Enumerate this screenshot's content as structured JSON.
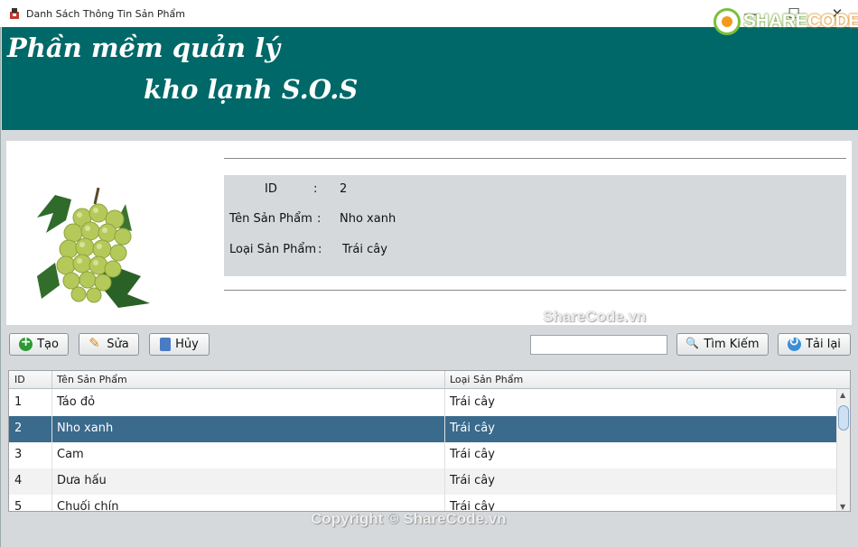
{
  "window": {
    "title": "Danh Sách Thông Tin Sản Phẩm",
    "minimize_glyph": "—",
    "maximize_glyph": "☐",
    "close_glyph": "✕"
  },
  "logo": {
    "share": "SHARE",
    "code": "CODE.vn"
  },
  "banner": {
    "line1": "Phần mềm quản lý",
    "line2": "kho lạnh S.O.S",
    "background": "#006868"
  },
  "details": {
    "id_label": "ID",
    "id_sep": ":",
    "id_value": "2",
    "name_label": "Tên Sản Phẩm",
    "name_sep": ":",
    "name_value": "Nho xanh",
    "type_label": "Loại Sản Phẩm",
    "type_sep": ":",
    "type_value": "Trái cây"
  },
  "watermark": "ShareCode.vn",
  "toolbar": {
    "create": "Tạo",
    "edit": "Sửa",
    "cancel": "Hủy",
    "search_value": "",
    "search": "Tìm Kiếm",
    "reload": "Tải lại"
  },
  "table": {
    "headers": [
      "ID",
      "Tên Sản Phẩm",
      "Loại Sản Phẩm"
    ],
    "rows": [
      {
        "id": "1",
        "name": "Táo đỏ",
        "type": "Trái cây"
      },
      {
        "id": "2",
        "name": "Nho xanh",
        "type": "Trái cây"
      },
      {
        "id": "3",
        "name": "Cam",
        "type": "Trái cây"
      },
      {
        "id": "4",
        "name": "Dưa hấu",
        "type": "Trái cây"
      },
      {
        "id": "5",
        "name": "Chuối chín",
        "type": "Trái cây"
      }
    ],
    "selected_index": 1,
    "selected_color": "#3a6a8c"
  },
  "copyright": "Copyright © ShareCode.vn"
}
